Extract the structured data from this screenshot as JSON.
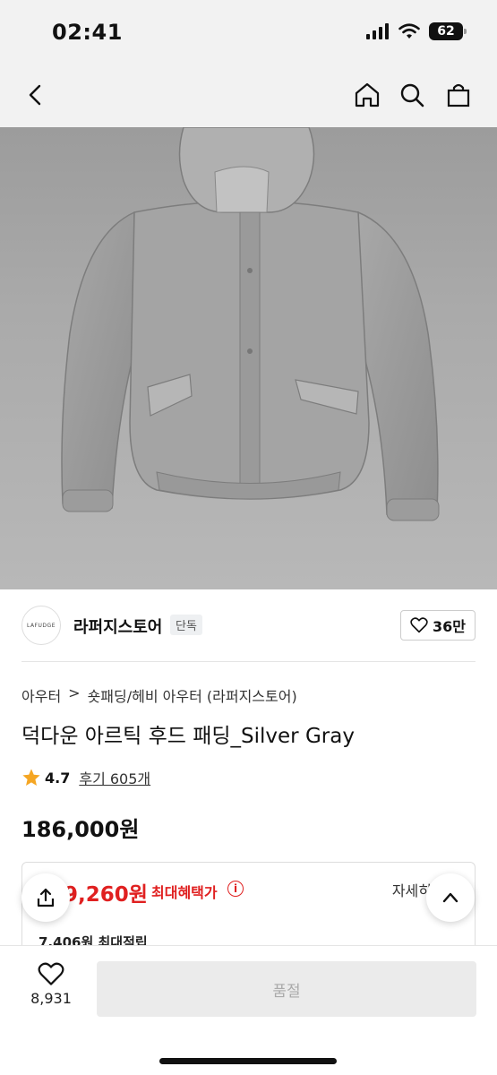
{
  "status": {
    "time": "02:41",
    "battery": "62"
  },
  "store": {
    "name": "라퍼지스토어",
    "badge": "단독",
    "logo_text": "LAFUDGE",
    "likes": "36만"
  },
  "breadcrumb": {
    "category": "아우터",
    "subcategory": "숏패딩/헤비 아우터 (라퍼지스토어)"
  },
  "product": {
    "title": "덕다운 아르틱 후드 패딩_Silver Gray",
    "rating": "4.7",
    "reviews": "후기 605개",
    "price": "186,000원"
  },
  "benefit": {
    "amount": "9,260원",
    "label": "최대혜택가",
    "detail": "자세히",
    "points": "7,406원 최대적립"
  },
  "bottom": {
    "wish_count": "8,931",
    "action_label": "품절"
  },
  "colors": {
    "accent_red": "#e02020",
    "star": "#f5a623"
  }
}
